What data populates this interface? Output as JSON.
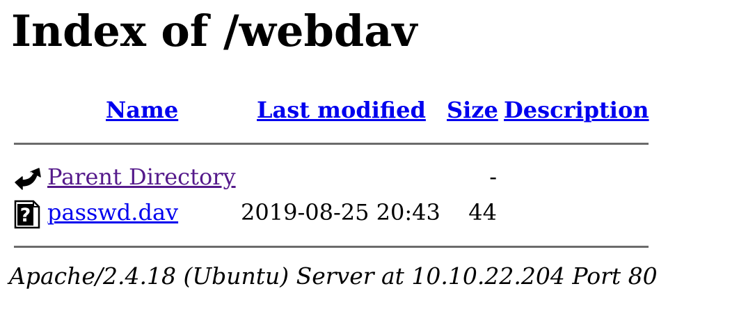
{
  "page": {
    "heading": "Index of /webdav"
  },
  "table": {
    "columns": {
      "name": "Name",
      "last_modified": "Last modified",
      "size": "Size",
      "description": "Description"
    },
    "rows": [
      {
        "icon": "back-arrow-icon",
        "name": "Parent Directory",
        "last_modified": "",
        "size": "-",
        "description": ""
      },
      {
        "icon": "unknown-file-icon",
        "name": "passwd.dav",
        "last_modified": "2019-08-25 20:43",
        "size": "44",
        "description": ""
      }
    ]
  },
  "footer": {
    "address": "Apache/2.4.18 (Ubuntu) Server at 10.10.22.204 Port 80"
  },
  "colors": {
    "link": "#0000ee",
    "visited_link": "#551a8b",
    "rule": "#6b6b6b"
  }
}
